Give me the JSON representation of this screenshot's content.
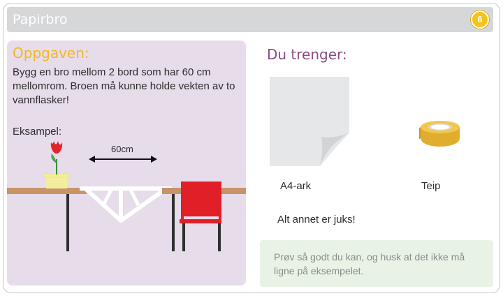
{
  "header": {
    "title": "Papirbro",
    "badge": "6"
  },
  "task": {
    "heading": "Oppgaven:",
    "text": "Bygg en bro mellom 2 bord som har 60 cm mellomrom. Broen må kunne holde vekten av to vannflasker!",
    "example_label": "Eksampel:",
    "dimension_label": "60cm"
  },
  "needs": {
    "heading": "Du trenger:",
    "items": [
      {
        "label": "A4-ark",
        "icon": "paper-sheet-icon"
      },
      {
        "label": "Teip",
        "icon": "tape-roll-icon"
      }
    ],
    "note": "Alt annet er juks!"
  },
  "hint": {
    "text": "Prøv så godt du kan, og husk at det ikke må ligne på eksempelet."
  },
  "colors": {
    "title_bar": "#d6d7d9",
    "badge": "#f3c21b",
    "left_panel": "#e7dcea",
    "task_heading": "#f1b820",
    "needs_heading": "#8a4a86",
    "hint_box": "#e8f3e6",
    "table": "#c9936a",
    "chair": "#e01f26",
    "tape": "#e1ad2f"
  }
}
